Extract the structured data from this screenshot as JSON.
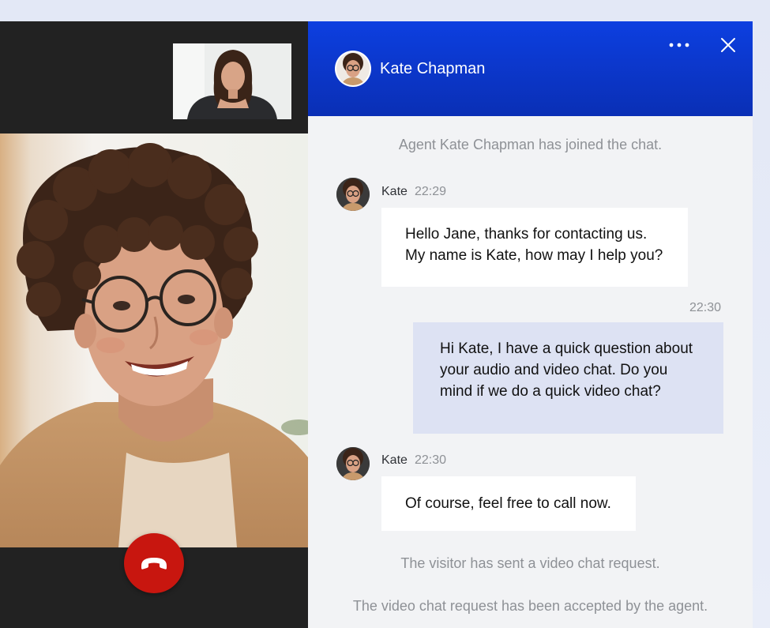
{
  "call": {
    "end_call_icon": "phone-hangup-icon",
    "end_call_color": "#c8160f"
  },
  "chat": {
    "header": {
      "agent_name": "Kate Chapman",
      "more_icon": "more-horizontal-icon",
      "close_icon": "close-icon",
      "background": "#0a2fb5"
    },
    "messages": {
      "joined": "Agent Kate Chapman has joined the chat.",
      "m1": {
        "sender": "Kate",
        "time": "22:29",
        "text": "Hello Jane, thanks for contacting us.\nMy name is Kate, how may I help you?"
      },
      "m2": {
        "time": "22:30",
        "text": "Hi Kate, I have a quick question about\nyour audio and video chat. Do you\nmind if we do a quick video chat?"
      },
      "m3": {
        "sender": "Kate",
        "time": "22:30",
        "text": "Of course, feel free to call now."
      },
      "video_request": "The visitor has sent a video chat request.",
      "video_accepted": "The video chat request has been accepted by the agent."
    }
  }
}
